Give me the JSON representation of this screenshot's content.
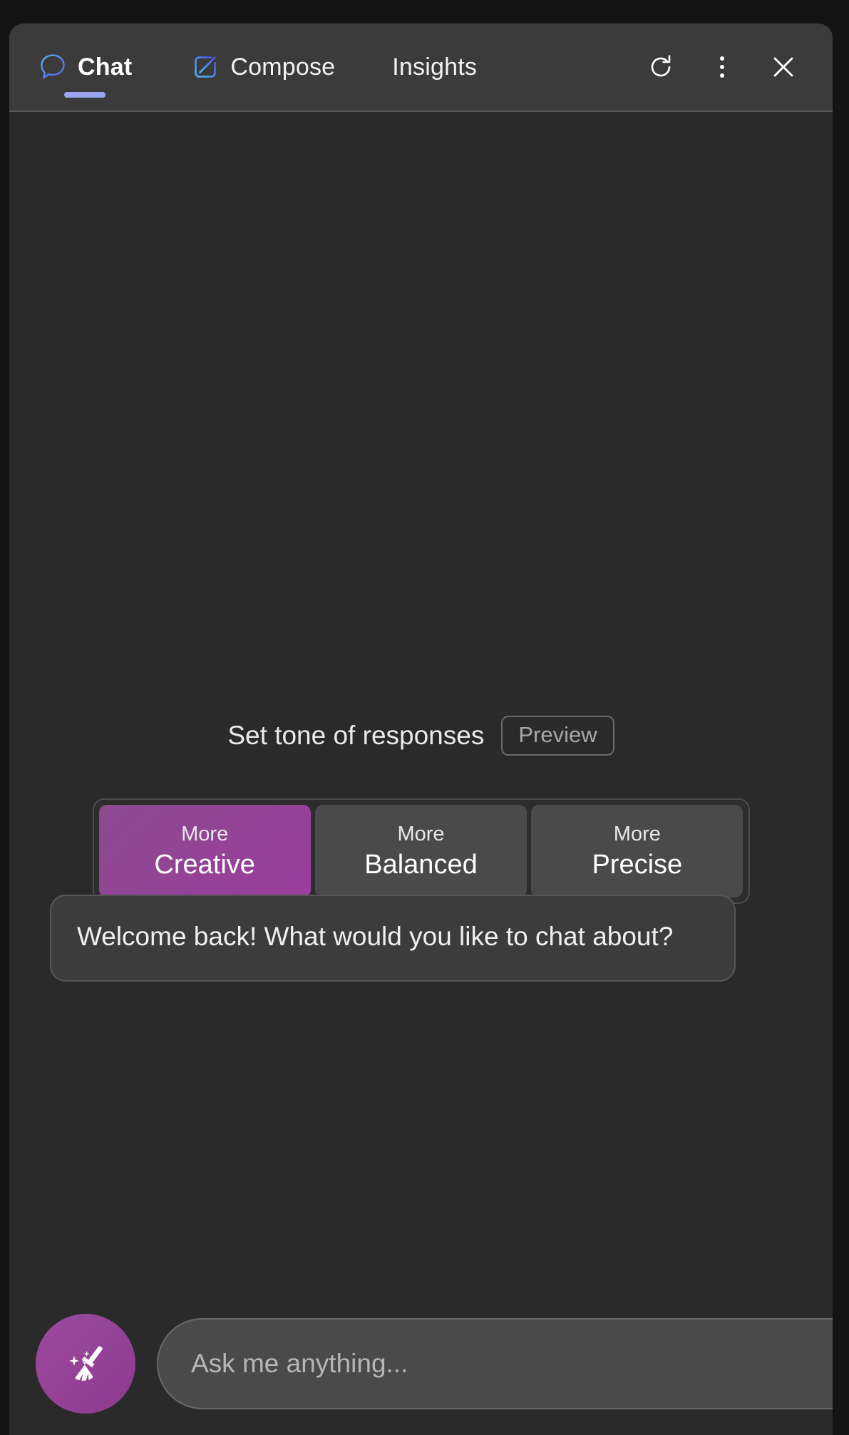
{
  "window": {
    "title": "Chat assistant sidebar"
  },
  "header": {
    "tabs": [
      {
        "id": "chat",
        "label": "Chat",
        "icon": "chat-bubble-icon",
        "active": true
      },
      {
        "id": "compose",
        "label": "Compose",
        "icon": "compose-pencil-icon",
        "active": false
      },
      {
        "id": "insights",
        "label": "Insights",
        "icon": "none",
        "active": false
      }
    ],
    "actions": [
      {
        "id": "refresh",
        "icon": "refresh-icon",
        "label": "Refresh"
      },
      {
        "id": "more",
        "icon": "more-vertical-icon",
        "label": "More options"
      },
      {
        "id": "close",
        "icon": "close-icon",
        "label": "Close"
      }
    ],
    "colors": {
      "background": "#3b3b3b",
      "tab_accent": "#9aa7f0",
      "icon_blue": "#4a9eff"
    }
  },
  "tone": {
    "title": "Set tone of responses",
    "preview_badge": "Preview",
    "options": [
      {
        "pre": "More",
        "name": "Creative",
        "selected": true
      },
      {
        "pre": "More",
        "name": "Balanced",
        "selected": false
      },
      {
        "pre": "More",
        "name": "Precise",
        "selected": false
      }
    ],
    "selected_value": "More Creative",
    "colors": {
      "selected_gradient_start": "#8c4a90",
      "selected_gradient_end": "#9a3d9c",
      "unselected": "#4a4a4a"
    }
  },
  "conversation": {
    "messages": [
      {
        "author": "assistant",
        "text": "Welcome back! What would you like to chat about?"
      }
    ]
  },
  "composer": {
    "new_topic_icon": "broom-sparkle-icon",
    "input_value": "",
    "input_placeholder": "Ask me anything...",
    "accent": "#9c4a9e"
  }
}
